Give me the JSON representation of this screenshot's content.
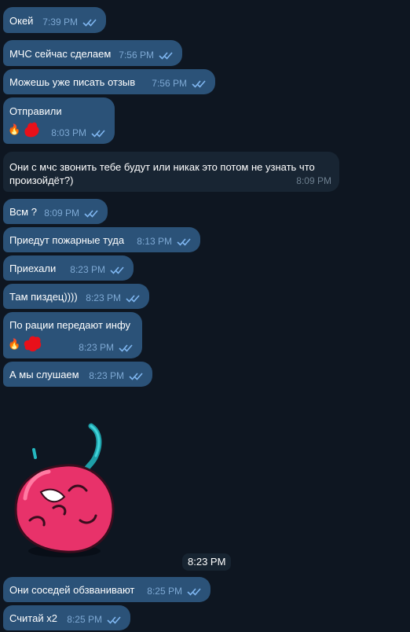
{
  "messages": [
    {
      "text": "Окей",
      "time": "7:39 PM"
    },
    {
      "text": "МЧС сейчас сделаем",
      "time": "7:56 PM"
    },
    {
      "text": "Можешь уже писать отзыв",
      "time": "7:56 PM"
    },
    {
      "text": "Отправили",
      "time": "8:03 PM",
      "reaction": "🔥"
    },
    {
      "text": "Они с мчс звонить тебе будут или никак это потом не узнать что произойдёт?)",
      "time": "8:09 PM"
    },
    {
      "text": "Всм ?",
      "time": "8:09 PM"
    },
    {
      "text": "Приедут пожарные туда",
      "time": "8:13 PM"
    },
    {
      "text": "Приехали",
      "time": "8:23 PM"
    },
    {
      "text": "Там пиздец))))",
      "time": "8:23 PM"
    },
    {
      "text": "По рации передают инфу",
      "time": "8:23 PM",
      "reaction": "🔥"
    },
    {
      "text": "А мы слушаем",
      "time": "8:23 PM"
    },
    {
      "text": "Они соседей обзванивают",
      "time": "8:25 PM"
    },
    {
      "text": "Считай x2",
      "time": "8:25 PM"
    }
  ],
  "sticker": {
    "icon": "cherry-sticker-icon",
    "time": "8:23 PM"
  },
  "colors": {
    "background": "#0e1621",
    "outgoing": "#2b5278",
    "incoming": "#182533",
    "tick": "#7fb6f0",
    "reaction_blob": "#e8101a"
  }
}
